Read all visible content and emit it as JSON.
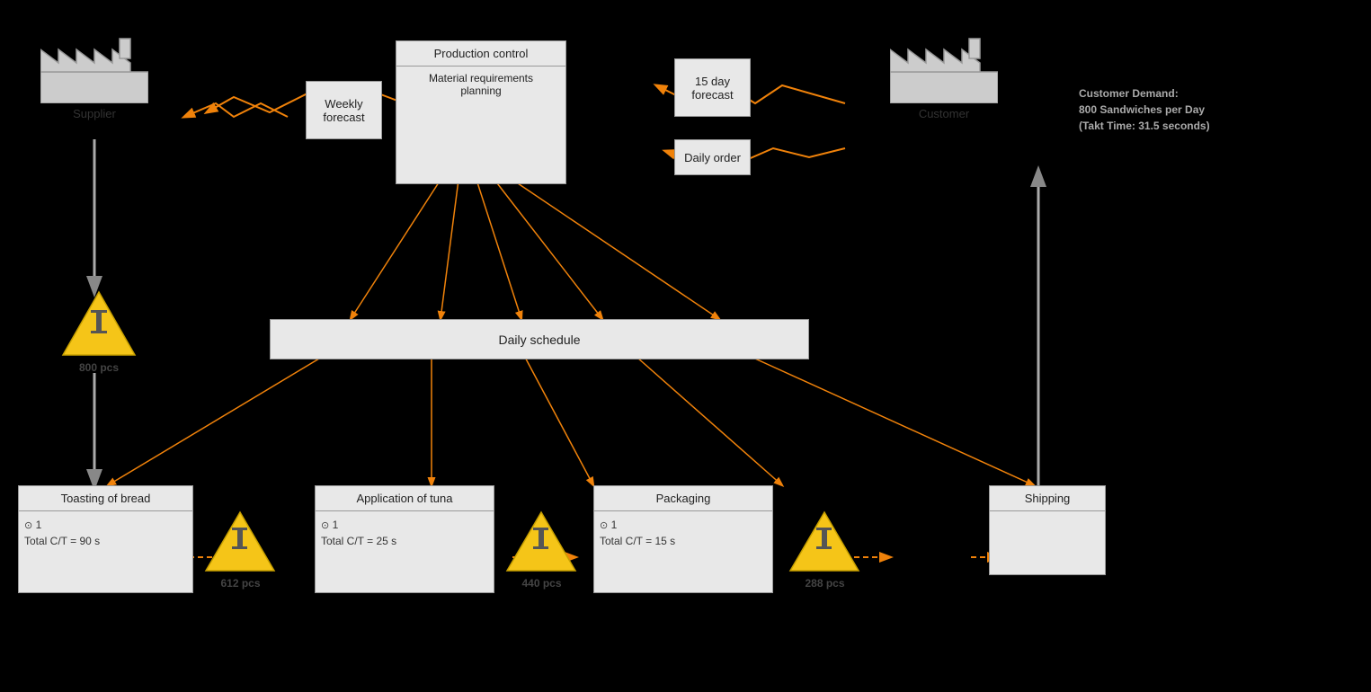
{
  "supplier": {
    "label": "Supplier"
  },
  "customer": {
    "label": "Customer"
  },
  "customer_info": {
    "line1": "Customer Demand:",
    "line2": "800 Sandwiches per Day",
    "line3": "(Takt Time: 31.5 seconds)"
  },
  "production_control": {
    "title": "Production control",
    "sub": "Material requirements\nplanning"
  },
  "weekly_forecast": {
    "label": "Weekly\nforecast"
  },
  "day15_forecast": {
    "label": "15 day\nforecast"
  },
  "daily_order": {
    "label": "Daily order"
  },
  "daily_schedule": {
    "label": "Daily schedule"
  },
  "inventory_supplier": {
    "label": "800 pcs"
  },
  "inventory_1": {
    "label": "612 pcs"
  },
  "inventory_2": {
    "label": "440 pcs"
  },
  "inventory_3": {
    "label": "288 pcs"
  },
  "process_toasting": {
    "title": "Toasting of bread",
    "operator": "1",
    "ct": "Total C/T = 90 s"
  },
  "process_tuna": {
    "title": "Application of tuna",
    "operator": "1",
    "ct": "Total C/T = 25 s"
  },
  "process_packaging": {
    "title": "Packaging",
    "operator": "1",
    "ct": "Total C/T = 15 s"
  },
  "process_shipping": {
    "title": "Shipping"
  },
  "colors": {
    "orange": "#f0820a",
    "triangle_fill": "#f5c518",
    "box_bg": "#e0e0e0",
    "box_border": "#aaa",
    "arrow_push": "#f0820a"
  }
}
